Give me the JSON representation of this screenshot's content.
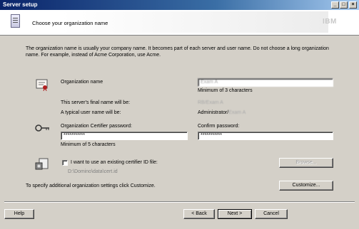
{
  "window": {
    "title": "Server setup"
  },
  "header": {
    "title": "Choose your organization name",
    "brand": "IBM"
  },
  "description": "The organization name is usually your company name. It becomes part of each server and user name. Do not choose a long organization name. For example, instead of Acme Corporation, use Acme.",
  "org": {
    "label": "Organization name",
    "value": "Exam A",
    "hint": "Minimum of 3 characters"
  },
  "server": {
    "label": "This server's final name will be:",
    "value": "RB/Exam A"
  },
  "user": {
    "label": "A typical user name will be:",
    "prefix": "Administrator/",
    "value": "Exam A"
  },
  "certifier": {
    "label": "Organization Certifier password:",
    "value": "***********",
    "hint": "Minimum of 5 characters"
  },
  "confirm": {
    "label": "Confirm password:",
    "value": "***********"
  },
  "existing": {
    "label": "I want to use an existing certifier ID file:",
    "path": "D:\\Domino\\data\\cert.id",
    "checked": false
  },
  "customize": {
    "text": "To specify additional organization settings click Customize."
  },
  "buttons": {
    "browse": "Browse...",
    "customize": "Customize...",
    "help": "Help",
    "back": "< Back",
    "next": "Next >",
    "cancel": "Cancel"
  },
  "colors": {
    "titlebar": "#0a246a",
    "face": "#d4d0c8"
  }
}
